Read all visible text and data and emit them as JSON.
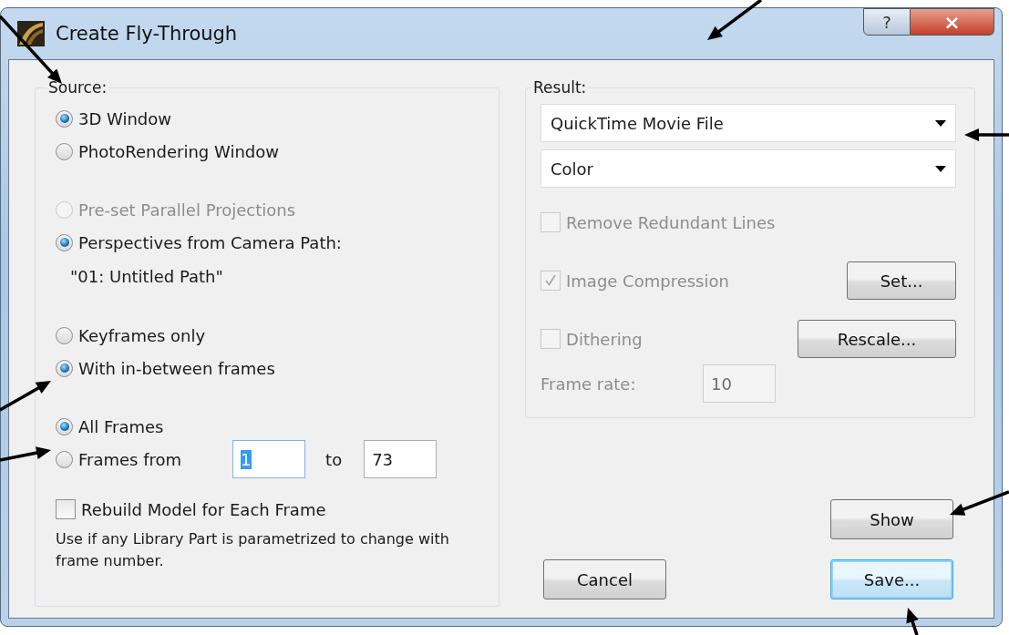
{
  "window": {
    "title": "Create Fly-Through",
    "help_button": "?",
    "close_button": "×"
  },
  "source": {
    "label": "Source:",
    "groups": [
      {
        "options": [
          {
            "label": "3D Window",
            "selected": true,
            "disabled": false
          },
          {
            "label": "PhotoRendering Window",
            "selected": false,
            "disabled": false
          }
        ]
      },
      {
        "options": [
          {
            "label": "Pre-set Parallel Projections",
            "selected": false,
            "disabled": true
          },
          {
            "label": "Perspectives from Camera Path:",
            "selected": true,
            "disabled": false
          }
        ],
        "path": "\"01: Untitled Path\""
      },
      {
        "options": [
          {
            "label": "Keyframes only",
            "selected": false,
            "disabled": false
          },
          {
            "label": "With in-between frames",
            "selected": true,
            "disabled": false
          }
        ]
      },
      {
        "options": [
          {
            "label": "All Frames",
            "selected": true,
            "disabled": false
          },
          {
            "label": "Frames from",
            "selected": false,
            "disabled": false
          }
        ]
      }
    ],
    "range": {
      "from": "1",
      "from_selected": true,
      "to_label": "to",
      "to": "73"
    },
    "rebuild": {
      "label": "Rebuild Model for Each Frame",
      "checked": false,
      "disabled": false
    },
    "note": "Use if any Library Part is parametrized to change with frame number."
  },
  "result": {
    "label": "Result:",
    "dropdowns": [
      {
        "value": "QuickTime Movie File"
      },
      {
        "value": "Color"
      }
    ],
    "checkboxes": [
      {
        "label": "Remove Redundant Lines",
        "checked": false,
        "disabled": true
      },
      {
        "label": "Image Compression",
        "checked": true,
        "disabled": true,
        "button": "Set..."
      },
      {
        "label": "Dithering",
        "checked": false,
        "disabled": true,
        "button": "Rescale..."
      }
    ],
    "frame_rate": {
      "label": "Frame rate:",
      "value": "10",
      "disabled": true
    }
  },
  "buttons": [
    {
      "label": "Show",
      "kind": "show",
      "default": false
    },
    {
      "label": "Cancel",
      "kind": "cancel",
      "default": false
    },
    {
      "label": "Save...",
      "kind": "save",
      "default": true
    }
  ]
}
